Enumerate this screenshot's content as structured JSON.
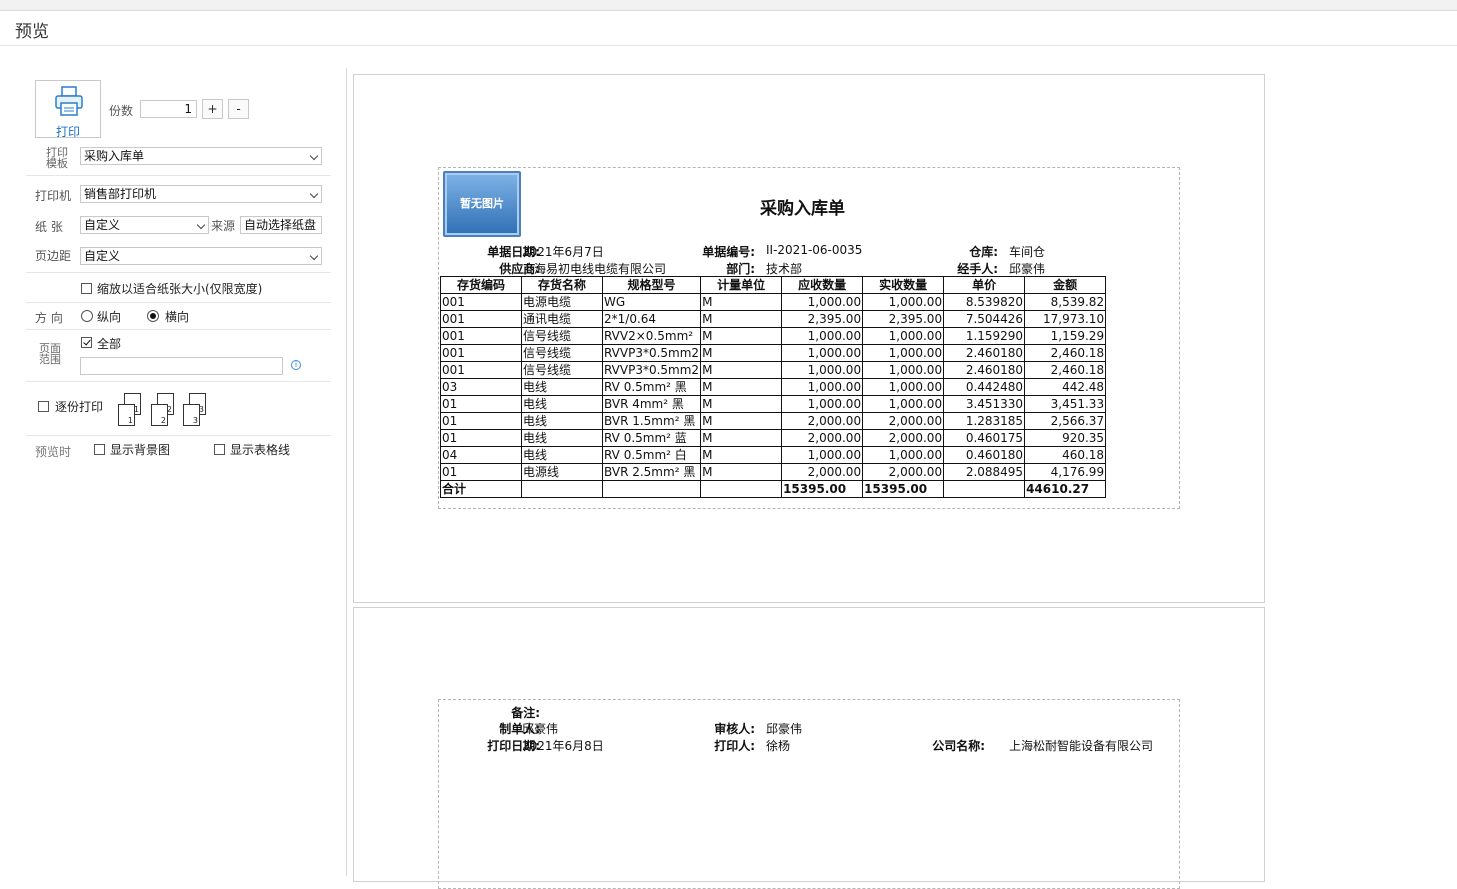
{
  "window": {
    "title": "预览"
  },
  "left": {
    "print_label": "打印",
    "copies": {
      "label": "份数",
      "value": "1",
      "plus": "+",
      "minus": "-"
    },
    "template": {
      "label_line1": "打印",
      "label_line2": "模板",
      "value": "采购入库单"
    },
    "printer": {
      "label": "打印机",
      "value": "销售部打印机"
    },
    "paper": {
      "label": "纸  张",
      "value": "自定义",
      "source_label": "来源",
      "source_value": "自动选择纸盘"
    },
    "margin": {
      "label": "页边距",
      "value": "自定义"
    },
    "fit_option": {
      "label": "缩放以适合纸张大小(仅限宽度)",
      "checked": false
    },
    "orientation": {
      "label": "方  向",
      "portrait": "纵向",
      "landscape": "横向",
      "selected": "landscape"
    },
    "range": {
      "label_line1": "页面",
      "label_line2": "范围",
      "all_label": "全部",
      "all_checked": true,
      "pages_value": ""
    },
    "collate": {
      "label": "逐份打印",
      "checked": false,
      "page_numbers": [
        "1",
        "2",
        "3",
        "1",
        "2",
        "3"
      ]
    },
    "preview_options": {
      "label": "预览时",
      "show_bg": "显示背景图",
      "show_grid": "显示表格线"
    }
  },
  "doc": {
    "no_image": "暂无图片",
    "title": "采购入库单",
    "header": {
      "date_label": "单据日期:",
      "date_value": "2021年6月7日",
      "number_label": "单据编号:",
      "number_value": "II-2021-06-0035",
      "warehouse_label": "仓库:",
      "warehouse_value": "车间仓",
      "supplier_label": "供应商:",
      "supplier_value": "上海易初电线电缆有限公司",
      "dept_label": "部门:",
      "dept_value": "技术部",
      "handler_label": "经手人:",
      "handler_value": "邱豪伟"
    },
    "columns": [
      "存货编码",
      "存货名称",
      "规格型号",
      "计量单位",
      "应收数量",
      "实收数量",
      "单价",
      "金额"
    ],
    "rows": [
      [
        "001",
        "电源电缆",
        "WG",
        "M",
        "1,000.00",
        "1,000.00",
        "8.539820",
        "8,539.82"
      ],
      [
        "001",
        "通讯电缆",
        "2*1/0.64",
        "M",
        "2,395.00",
        "2,395.00",
        "7.504426",
        "17,973.10"
      ],
      [
        "001",
        "信号线缆",
        "RVV2×0.5mm²",
        "M",
        "1,000.00",
        "1,000.00",
        "1.159290",
        "1,159.29"
      ],
      [
        "001",
        "信号线缆",
        "RVVP3*0.5mm2",
        "M",
        "1,000.00",
        "1,000.00",
        "2.460180",
        "2,460.18"
      ],
      [
        "001",
        "信号线缆",
        "RVVP3*0.5mm2",
        "M",
        "1,000.00",
        "1,000.00",
        "2.460180",
        "2,460.18"
      ],
      [
        "03",
        "电线",
        "RV 0.5mm² 黑",
        "M",
        "1,000.00",
        "1,000.00",
        "0.442480",
        "442.48"
      ],
      [
        "01",
        "电线",
        "BVR 4mm² 黑",
        "M",
        "1,000.00",
        "1,000.00",
        "3.451330",
        "3,451.33"
      ],
      [
        "01",
        "电线",
        "BVR 1.5mm² 黑",
        "M",
        "2,000.00",
        "2,000.00",
        "1.283185",
        "2,566.37"
      ],
      [
        "01",
        "电线",
        "RV 0.5mm² 蓝",
        "M",
        "2,000.00",
        "2,000.00",
        "0.460175",
        "920.35"
      ],
      [
        "04",
        "电线",
        "RV 0.5mm² 白",
        "M",
        "1,000.00",
        "1,000.00",
        "0.460180",
        "460.18"
      ],
      [
        "01",
        "电源线",
        "BVR 2.5mm² 黑",
        "M",
        "2,000.00",
        "2,000.00",
        "2.088495",
        "4,176.99"
      ]
    ],
    "total": {
      "label": "合计",
      "qty_due": "15395.00",
      "qty_recv": "15395.00",
      "amount": "44610.27"
    },
    "footer": {
      "remark_label": "备注:",
      "maker_label": "制单人:",
      "maker_value": "邱豪伟",
      "auditor_label": "审核人:",
      "auditor_value": "邱豪伟",
      "print_date_label": "打印日期:",
      "print_date_value": "2021年6月8日",
      "printer_person_label": "打印人:",
      "printer_person_value": "徐杨",
      "company_label": "公司名称:",
      "company_value": "上海松耐智能设备有限公司"
    }
  }
}
